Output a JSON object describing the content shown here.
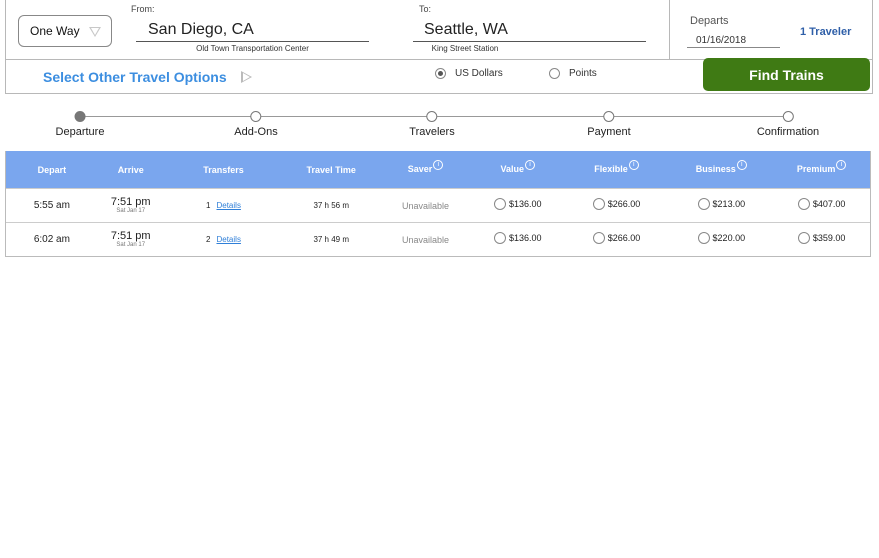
{
  "search": {
    "trip_type": "One Way",
    "from": {
      "caption": "From:",
      "city": "San Diego, CA",
      "station": "Old Town Transportation Center"
    },
    "to": {
      "caption": "To:",
      "city": "Seattle, WA",
      "station": "King Street Station"
    },
    "departs_label": "Departs",
    "departs_date": "01/16/2018",
    "travelers": "1 Traveler",
    "other_options": "Select Other Travel Options",
    "currency_usd": "US Dollars",
    "currency_points": "Points",
    "currency_selected": "US Dollars",
    "find_button": "Find Trains"
  },
  "steps": [
    {
      "label": "Departure",
      "done": true
    },
    {
      "label": "Add-Ons",
      "done": false
    },
    {
      "label": "Travelers",
      "done": false
    },
    {
      "label": "Payment",
      "done": false
    },
    {
      "label": "Confirmation",
      "done": false
    }
  ],
  "table": {
    "headers": {
      "depart": "Depart",
      "arrive": "Arrive",
      "transfers": "Transfers",
      "travel_time": "Travel Time",
      "saver": "Saver",
      "value": "Value",
      "flexible": "Flexible",
      "business": "Business",
      "premium": "Premium",
      "info_glyph": "i"
    },
    "details_link": "Details",
    "rows": [
      {
        "depart": "5:55 am",
        "arrive": "7:51 pm",
        "arrive_date": "Sat Jan 17",
        "transfers": "1",
        "travel_time": "37 h 56 m",
        "saver": "Unavailable",
        "value": "$136.00",
        "flexible": "$266.00",
        "business": "$213.00",
        "premium": "$407.00"
      },
      {
        "depart": "6:02 am",
        "arrive": "7:51 pm",
        "arrive_date": "Sat Jan 17",
        "transfers": "2",
        "travel_time": "37 h 49 m",
        "saver": "Unavailable",
        "value": "$136.00",
        "flexible": "$266.00",
        "business": "$220.00",
        "premium": "$359.00"
      }
    ]
  },
  "colors": {
    "accent_blue": "#3c8ee0",
    "header_blue": "#7aa6ee",
    "find_green": "#3f7a14",
    "traveler_blue": "#2f5fa8"
  }
}
